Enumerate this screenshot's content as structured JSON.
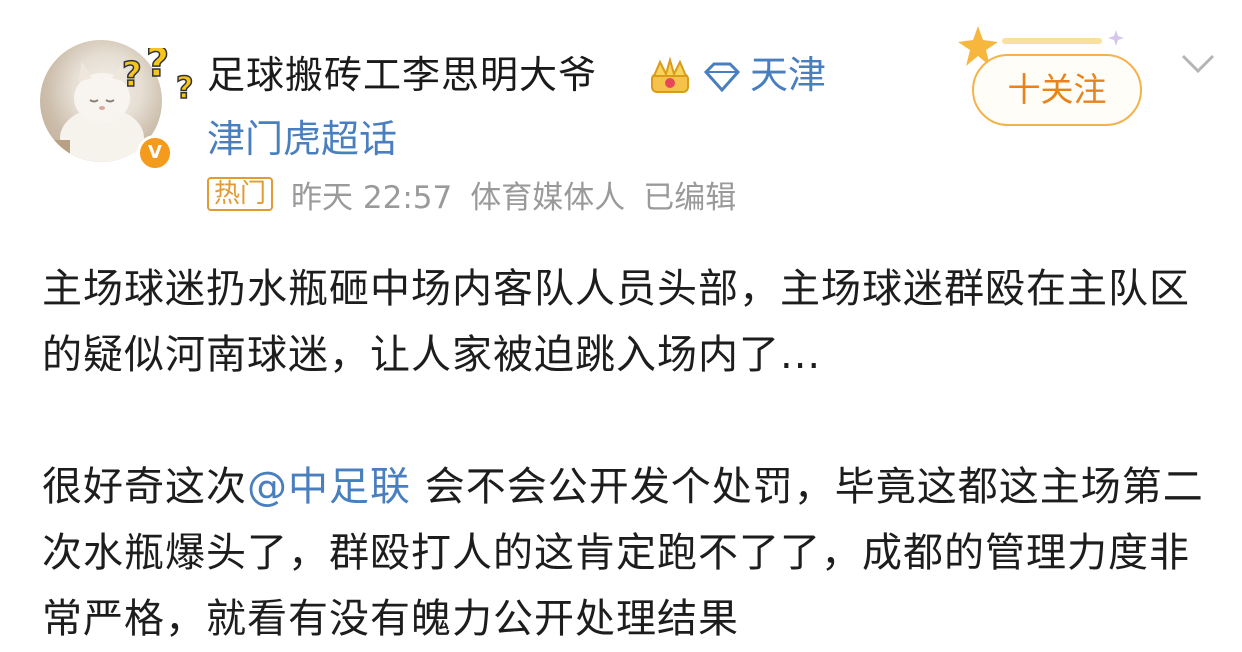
{
  "author": {
    "name": "足球搬砖工李思明大爷",
    "location": "天津",
    "avatar_icon": "cat-avatar-icon",
    "badge_icon": "verified-v-icon",
    "badge_text": "V"
  },
  "topic": "津门虎超话",
  "meta": {
    "hot_label": "热门",
    "time": "昨天 22:57",
    "role": "体育媒体人",
    "edited": "已编辑"
  },
  "follow_button": "十关注",
  "post": {
    "p1": "主场球迷扔水瓶砸中场内客队人员头部，主场球迷群殴在主队区的疑似河南球迷，让人家被迫跳入场内了...",
    "p2_before": "很好奇这次",
    "p2_mention": "@中足联",
    "p2_after": " 会不会公开发个处罚，毕竟这都这主场第二次水瓶爆头了，群殴打人的这肯定跑不了了，成都的管理力度非常严格，就看有没有魄力公开处理结果"
  },
  "colors": {
    "link": "#4a7fbf",
    "follow_border": "#f4b24b",
    "follow_text": "#e8831c",
    "hot": "#e19a34",
    "meta_text": "#9a9a9a"
  }
}
